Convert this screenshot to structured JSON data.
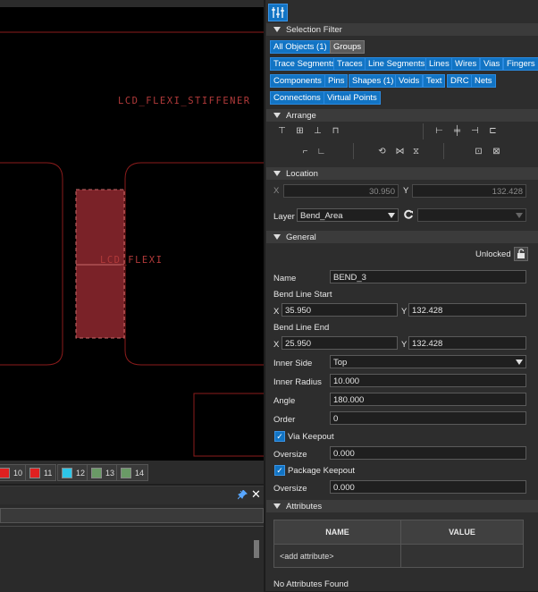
{
  "canvas": {
    "labels": {
      "stiffener": "LCD_FLEXI_STIFFENER",
      "flexi": "LCD_FLEXI"
    },
    "colors": {
      "outline": "#8c1c1c",
      "bend_fill": "#7a2228",
      "bend_border": "#c86a6a"
    }
  },
  "layerbar": {
    "layers": [
      {
        "label": "10",
        "color": "#e02020"
      },
      {
        "label": "11",
        "color": "#e02020"
      },
      {
        "label": "12",
        "color": "#2ec6e8"
      },
      {
        "label": "13",
        "color": "#6a9a66"
      },
      {
        "label": "14",
        "color": "#6a9a66"
      }
    ]
  },
  "dock": {
    "pin_icon": "pin-icon",
    "close_icon": "✕"
  },
  "panel": {
    "top_icon": "filter-settings-icon",
    "selection_filter": {
      "title": "Selection Filter",
      "row1": [
        {
          "label": "All Objects (1)",
          "active": true
        },
        {
          "label": "Groups",
          "active": false
        }
      ],
      "row2": [
        "Trace Segments",
        "Traces",
        "Line Segments",
        "Lines",
        "Wires",
        "Vias",
        "Fingers"
      ],
      "row3": [
        "Components",
        "Pins",
        "Shapes (1)",
        "Voids",
        "Text",
        "DRC",
        "Nets"
      ],
      "row4": [
        "Connections",
        "Virtual Points"
      ]
    },
    "arrange": {
      "title": "Arrange"
    },
    "location": {
      "title": "Location",
      "x_label": "X",
      "x_value": "30.950",
      "y_label": "Y",
      "y_value": "132.428",
      "layer_label": "Layer",
      "layer_value": "Bend_Area"
    },
    "general": {
      "title": "General",
      "lock_label": "Unlocked",
      "name_label": "Name",
      "name_value": "BEND_3",
      "bend_start_label": "Bend Line Start",
      "start_x_label": "X",
      "start_x": "35.950",
      "start_y_label": "Y",
      "start_y": "132.428",
      "bend_end_label": "Bend Line End",
      "end_x_label": "X",
      "end_x": "25.950",
      "end_y_label": "Y",
      "end_y": "132.428",
      "inner_side_label": "Inner Side",
      "inner_side_value": "Top",
      "inner_radius_label": "Inner Radius",
      "inner_radius_value": "10.000",
      "angle_label": "Angle",
      "angle_value": "180.000",
      "order_label": "Order",
      "order_value": "0",
      "via_keepout_label": "Via Keepout",
      "via_keepout_checked": true,
      "oversize1_label": "Oversize",
      "oversize1_value": "0.000",
      "package_keepout_label": "Package Keepout",
      "package_keepout_checked": true,
      "oversize2_label": "Oversize",
      "oversize2_value": "0.000"
    },
    "attributes": {
      "title": "Attributes",
      "col_name": "NAME",
      "col_value": "VALUE",
      "add_row": "<add attribute>",
      "status": "No Attributes Found"
    }
  }
}
